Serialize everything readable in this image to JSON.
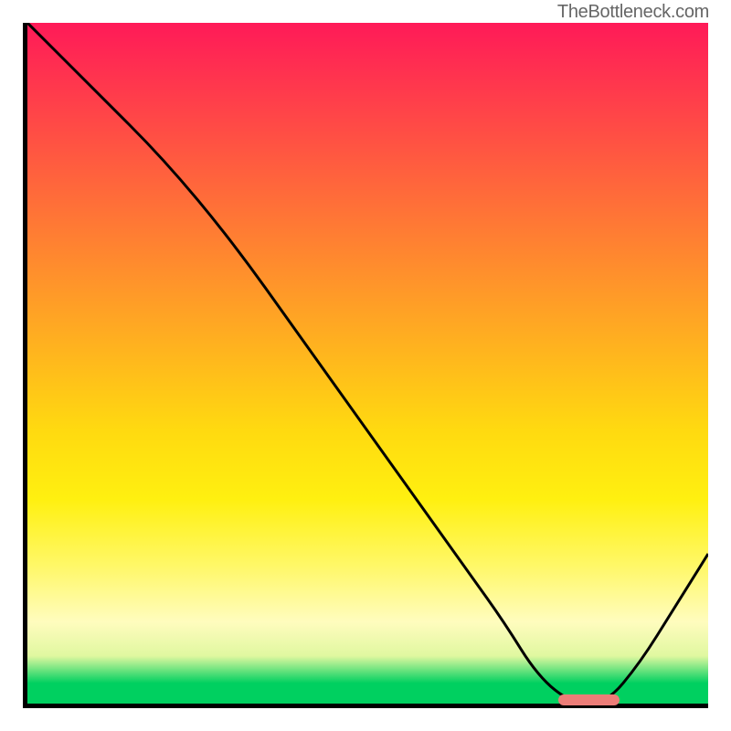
{
  "watermark": "TheBottleneck.com",
  "chart_data": {
    "type": "line",
    "title": "",
    "xlabel": "",
    "ylabel": "",
    "xlim": [
      0,
      100
    ],
    "ylim": [
      0,
      100
    ],
    "x": [
      0,
      10,
      20,
      30,
      40,
      50,
      60,
      65,
      70,
      75,
      80,
      85,
      90,
      95,
      100
    ],
    "y": [
      100,
      90,
      80,
      68,
      54,
      40,
      26,
      19,
      12,
      4,
      0,
      0,
      6,
      14,
      22
    ],
    "marker": {
      "x_start": 78,
      "x_end": 87,
      "y": 0
    },
    "background_gradient": {
      "top": "#ff1a58",
      "mid": "#ffd010",
      "bottom": "#00d060"
    }
  }
}
